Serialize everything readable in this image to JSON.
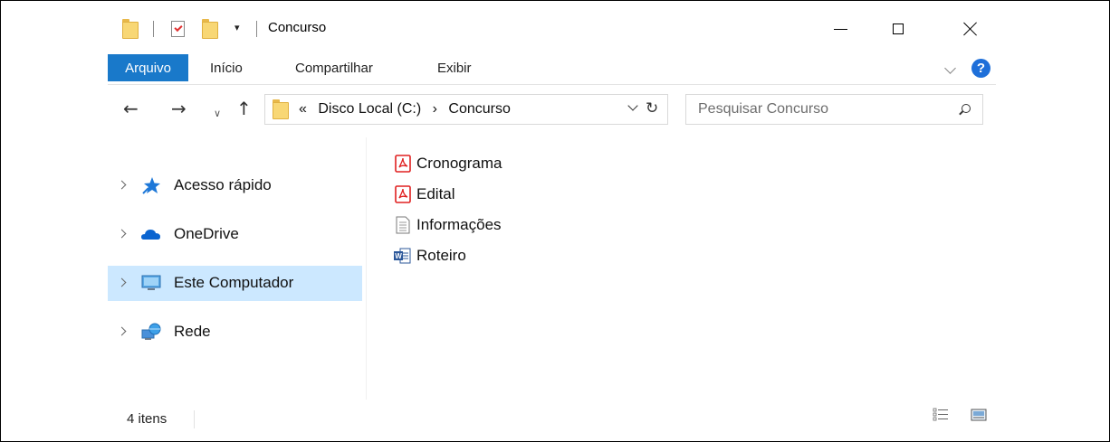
{
  "window": {
    "title": "Concurso",
    "qa_dropdown_glyph": "▾"
  },
  "ribbon": {
    "tabs": [
      {
        "label": "Arquivo",
        "active": true
      },
      {
        "label": "Início"
      },
      {
        "label": "Compartilhar"
      },
      {
        "label": "Exibir"
      }
    ],
    "help_label": "?"
  },
  "address": {
    "overflow": "«",
    "crumbs": [
      "Disco Local (C:)",
      "›",
      "Concurso"
    ]
  },
  "search": {
    "placeholder": "Pesquisar Concurso"
  },
  "navigation": {
    "items": [
      {
        "label": "Acesso rápido",
        "icon": "star-pin-icon"
      },
      {
        "label": "OneDrive",
        "icon": "cloud-icon"
      },
      {
        "label": "Este Computador",
        "icon": "monitor-icon",
        "selected": true
      },
      {
        "label": "Rede",
        "icon": "network-icon"
      }
    ]
  },
  "files": [
    {
      "name": "Cronograma",
      "icon": "pdf-icon"
    },
    {
      "name": "Edital",
      "icon": "pdf-icon"
    },
    {
      "name": "Informações",
      "icon": "text-file-icon"
    },
    {
      "name": "Roteiro",
      "icon": "word-doc-icon"
    }
  ],
  "status": {
    "item_count": "4 itens"
  },
  "colors": {
    "accent": "#1979ca",
    "selection": "#cce8ff",
    "folder": "#f8d775",
    "pdf_red": "#e02020"
  }
}
